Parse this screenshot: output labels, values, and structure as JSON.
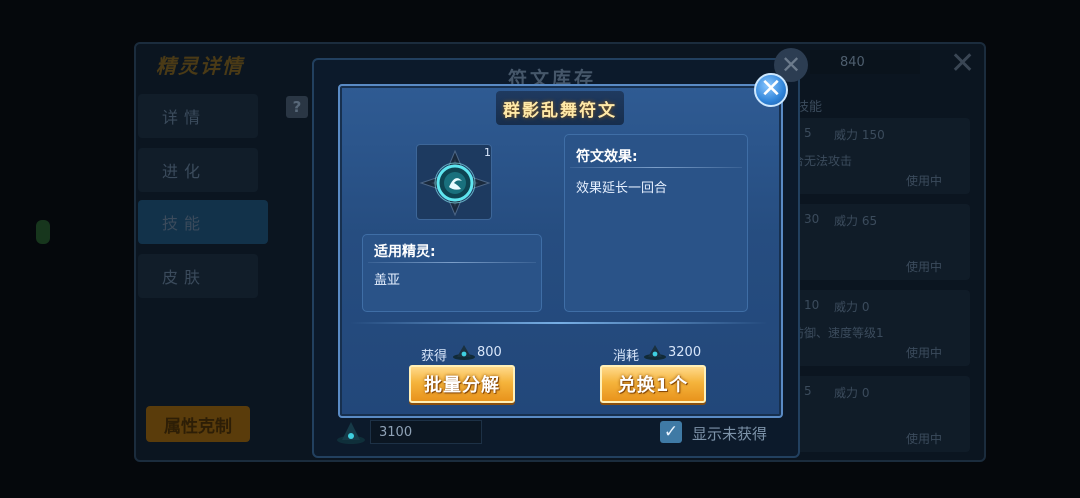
{
  "background": {
    "title": "精灵详情",
    "sidebar": [
      {
        "label": "详情"
      },
      {
        "label": "进化"
      },
      {
        "label": "技能"
      },
      {
        "label": "皮肤"
      }
    ],
    "attr_button": "属性克制",
    "top_value": "840",
    "skill_header": "技能",
    "skill_cards": [
      {
        "pp": "5",
        "power": "威力 150",
        "desc": "合无法攻击",
        "status": "使用中"
      },
      {
        "pp": "30",
        "power": "威力 65",
        "desc": "",
        "status": "使用中"
      },
      {
        "pp": "10",
        "power": "威力 0",
        "desc": "防御、速度等级1",
        "status": "使用中"
      },
      {
        "pp": "5",
        "power": "威力 0",
        "desc": "",
        "status": "使用中"
      }
    ]
  },
  "warehouse": {
    "title": "符文库存",
    "currency_value": "3100",
    "show_unobtained_label": "显示未获得",
    "show_unobtained_checked": true
  },
  "modal": {
    "title": "群影乱舞符文",
    "rune_count": "1",
    "effect_header": "符文效果:",
    "effect_text": "效果延长一回合",
    "applicable_header": "适用精灵:",
    "applicable_text": "盖亚",
    "gain_label": "获得",
    "gain_value": "800",
    "cost_label": "消耗",
    "cost_value": "3200",
    "decompose_button": "批量分解",
    "exchange_button": "兑换1个"
  },
  "colors": {
    "modal_blue": "#2f5b93",
    "gold_button": "#f5b43c",
    "title_gold": "#ffe9a8"
  },
  "icons": {
    "close": "close-icon",
    "rune": "rune-icon",
    "currency": "witch-hat-currency-icon",
    "check": "checkmark-icon"
  }
}
